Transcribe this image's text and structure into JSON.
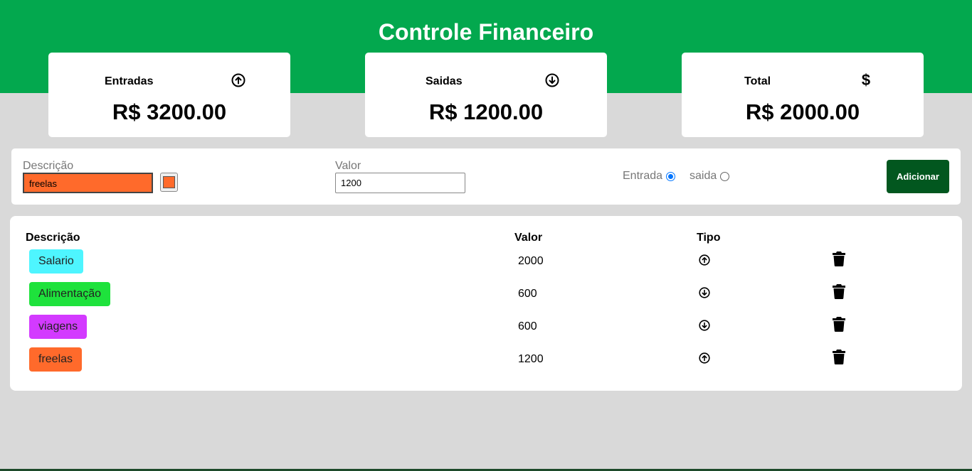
{
  "header": {
    "title": "Controle Financeiro"
  },
  "cards": [
    {
      "label": "Entradas",
      "icon": "arrow-circle-up-icon",
      "value": "R$ 3200.00"
    },
    {
      "label": "Saidas",
      "icon": "arrow-circle-down-icon",
      "value": "R$ 1200.00"
    },
    {
      "label": "Total",
      "icon": "dollar-icon",
      "symbol": "$",
      "value": "R$ 2000.00"
    }
  ],
  "form": {
    "description_label": "Descrição",
    "description_value": "freelas",
    "color_value": "#ff6a2b",
    "value_label": "Valor",
    "value_value": "1200",
    "radio_entrada": "Entrada",
    "radio_saida": "saida",
    "selected_type": "Entrada",
    "add_button": "Adicionar"
  },
  "table": {
    "headers": {
      "description": "Descrição",
      "value": "Valor",
      "type": "Tipo"
    },
    "rows": [
      {
        "description": "Salario",
        "color": "#4ef5ff",
        "value": "2000",
        "type": "entrada"
      },
      {
        "description": "Alimentação",
        "color": "#1ee23c",
        "value": "600",
        "type": "saida"
      },
      {
        "description": "viagens",
        "color": "#d33aff",
        "value": "600",
        "type": "saida"
      },
      {
        "description": "freelas",
        "color": "#ff6a2b",
        "value": "1200",
        "type": "entrada"
      }
    ]
  },
  "colors": {
    "header": "#03a84e",
    "button": "#02571f",
    "background": "#d9d9d9"
  }
}
